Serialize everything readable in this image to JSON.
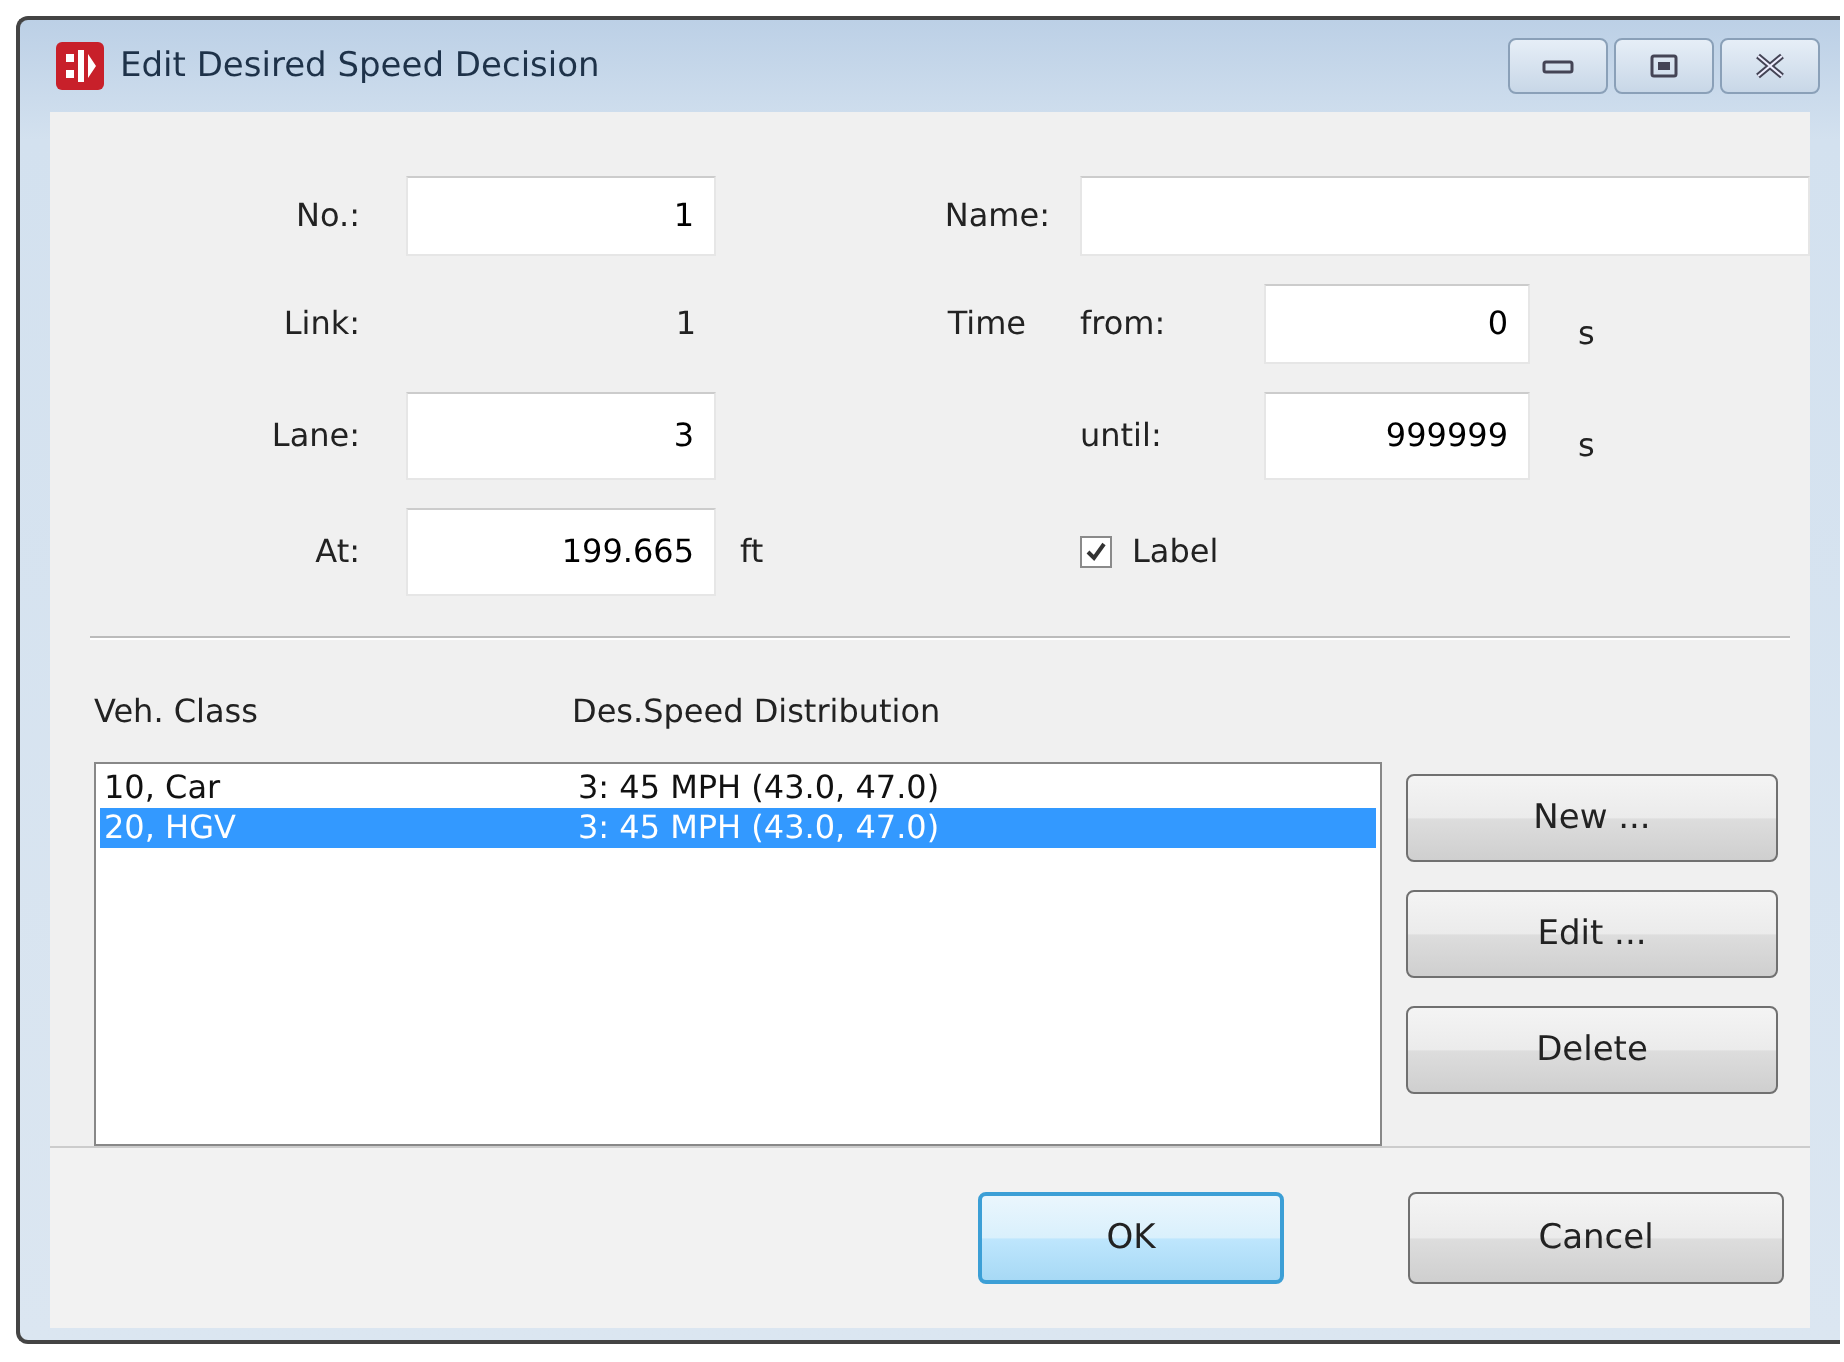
{
  "window": {
    "title": "Edit Desired Speed Decision"
  },
  "number": {
    "label": "No.:",
    "value": "1"
  },
  "link": {
    "label": "Link:",
    "value": "1"
  },
  "lane": {
    "label": "Lane:",
    "value": "3"
  },
  "at": {
    "label": "At:",
    "value": "199.665",
    "unit": "ft"
  },
  "name": {
    "label": "Name:"
  },
  "time": {
    "label": "Time",
    "from": {
      "label": "from:",
      "value": "0",
      "unit": "s"
    },
    "until": {
      "label": "until:",
      "value": "999999",
      "unit": "s"
    }
  },
  "label_checkbox": {
    "label": "Label",
    "checked": true
  },
  "list": {
    "columns": [
      "Veh. Class",
      "Des.Speed Distribution"
    ],
    "rows": [
      {
        "cells": [
          "10, Car",
          "3: 45 MPH (43.0, 47.0)"
        ],
        "selected": false
      },
      {
        "cells": [
          "20, HGV",
          "3: 45 MPH (43.0, 47.0)"
        ],
        "selected": true
      }
    ]
  },
  "side_buttons": [
    "New ...",
    "Edit ...",
    "Delete"
  ],
  "footer_buttons": [
    {
      "label": "OK",
      "default": true
    },
    {
      "label": "Cancel",
      "default": false
    }
  ]
}
